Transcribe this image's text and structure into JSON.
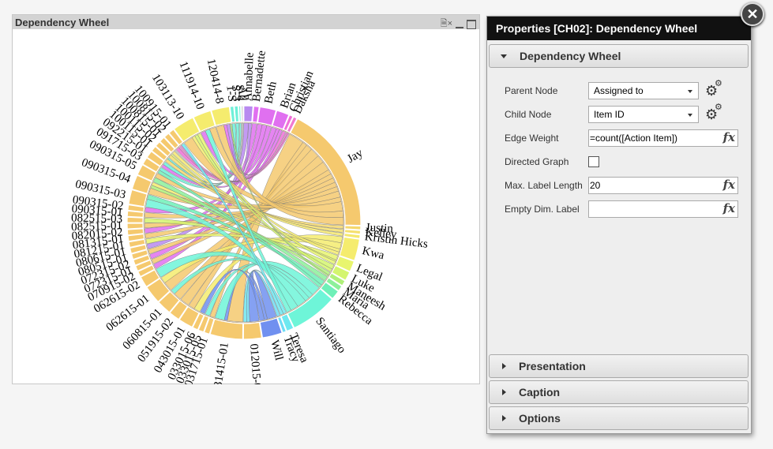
{
  "chart_window": {
    "title": "Dependency Wheel",
    "icons": [
      "clear-selection-icon",
      "minimize-icon",
      "maximize-icon"
    ]
  },
  "properties": {
    "title": "Properties [CH02]: Dependency Wheel",
    "section_main": "Dependency Wheel",
    "fields": {
      "parent_node": {
        "label": "Parent Node",
        "value": "Assigned to"
      },
      "child_node": {
        "label": "Child Node",
        "value": "Item ID"
      },
      "edge_weight": {
        "label": "Edge Weight",
        "value": "=count([Action Item])"
      },
      "directed_graph": {
        "label": "Directed Graph",
        "checked": false
      },
      "max_label_length": {
        "label": "Max. Label Length",
        "value": "20"
      },
      "empty_dim_label": {
        "label": "Empty Dim. Label",
        "value": ""
      }
    },
    "fx_label": "fx",
    "sections": [
      "Presentation",
      "Caption",
      "Options"
    ]
  },
  "chart_data": {
    "type": "chord",
    "nodes": [
      {
        "label": "1-S",
        "color": "#6ef0d8"
      },
      {
        "label": "S-3",
        "color": "#6ef0d8"
      },
      {
        "label": "S-4",
        "color": "#6ef0d8"
      },
      {
        "label": "All",
        "color": "#c8c8c8"
      },
      {
        "label": "Annabelle",
        "color": "#b88af0"
      },
      {
        "label": "Bernadette",
        "color": "#e070f0"
      },
      {
        "label": "Beth",
        "color": "#e070f0"
      },
      {
        "label": "Brian",
        "color": "#e070f0"
      },
      {
        "label": "Christian",
        "color": "#f070d8"
      },
      {
        "label": "Daksha",
        "color": "#f07ad0"
      },
      {
        "label": "Jay",
        "color": "#f5c96e"
      },
      {
        "label": "Justin",
        "color": "#f5d86e"
      },
      {
        "label": "Kelley",
        "color": "#f5e06e"
      },
      {
        "label": "Kristin Hicks",
        "color": "#f5e86e"
      },
      {
        "label": "Kwa",
        "color": "#f5ec6e"
      },
      {
        "label": "Legal",
        "color": "#e8f56e"
      },
      {
        "label": "Luke",
        "color": "#d4f56e"
      },
      {
        "label": "Maneesh",
        "color": "#b0f07a"
      },
      {
        "label": "Maria",
        "color": "#8cf09a"
      },
      {
        "label": "Rebecca",
        "color": "#6ef0b8"
      },
      {
        "label": "Santiago",
        "color": "#6ef5d8"
      },
      {
        "label": "Teresa",
        "color": "#6ee8f0"
      },
      {
        "label": "Tracy",
        "color": "#6edcf5"
      },
      {
        "label": "Will",
        "color": "#7090f0"
      },
      {
        "label": "012015-01",
        "color": "#f5c96e"
      },
      {
        "label": "031415-01",
        "color": "#f5c96e"
      },
      {
        "label": "031715-01",
        "color": "#f5c96e"
      },
      {
        "label": "033015-05",
        "color": "#f5c96e"
      },
      {
        "label": "033015-06",
        "color": "#f5c96e"
      },
      {
        "label": "043015-01",
        "color": "#f5c96e"
      },
      {
        "label": "051915-02",
        "color": "#f5c96e"
      },
      {
        "label": "060815-01",
        "color": "#f5c96e"
      },
      {
        "label": "062615-01",
        "color": "#f5c96e"
      },
      {
        "label": "062615-02",
        "color": "#f5c96e"
      },
      {
        "label": "070915-02",
        "color": "#f5c96e"
      },
      {
        "label": "072315-01",
        "color": "#f5c96e"
      },
      {
        "label": "072315-02",
        "color": "#f5c96e"
      },
      {
        "label": "080515-01",
        "color": "#f5c96e"
      },
      {
        "label": "080615-01",
        "color": "#f5c96e"
      },
      {
        "label": "081215-01",
        "color": "#f5c96e"
      },
      {
        "label": "081315-01",
        "color": "#f5c96e"
      },
      {
        "label": "082015-02",
        "color": "#f5c96e"
      },
      {
        "label": "082515-01",
        "color": "#f5c96e"
      },
      {
        "label": "082515-03",
        "color": "#f5c96e"
      },
      {
        "label": "090315-01",
        "color": "#f5c96e"
      },
      {
        "label": "090315-02",
        "color": "#f5c96e"
      },
      {
        "label": "090315-03",
        "color": "#f5c96e"
      },
      {
        "label": "090315-04",
        "color": "#f5c96e"
      },
      {
        "label": "090315-05",
        "color": "#f5c96e"
      },
      {
        "label": "091715-03",
        "color": "#f5c96e"
      },
      {
        "label": "092215-01",
        "color": "#f5c96e"
      },
      {
        "label": "100115-01",
        "color": "#f5c96e"
      },
      {
        "label": "100115-02",
        "color": "#f5c96e"
      },
      {
        "label": "100815-01",
        "color": "#f5c96e"
      },
      {
        "label": "100815-02",
        "color": "#f5c96e"
      },
      {
        "label": "100915-01",
        "color": "#f5c96e"
      },
      {
        "label": "103113-10",
        "color": "#f5ec6e"
      },
      {
        "label": "111914-10",
        "color": "#f5ec6e"
      },
      {
        "label": "120414-8",
        "color": "#f5ec6e"
      }
    ],
    "edges": [
      [
        "012015-01",
        "Will",
        6
      ],
      [
        "012015-01",
        "Tracy",
        2
      ],
      [
        "012015-01",
        "Teresa",
        2
      ],
      [
        "031415-01",
        "Jay",
        10
      ],
      [
        "031415-01",
        "Will",
        2
      ],
      [
        "031415-01",
        "Santiago",
        6
      ],
      [
        "031715-01",
        "Jay",
        3
      ],
      [
        "033015-05",
        "Santiago",
        3
      ],
      [
        "033015-06",
        "Will",
        3
      ],
      [
        "043015-01",
        "Kwa",
        4
      ],
      [
        "043015-01",
        "Jay",
        4
      ],
      [
        "051915-02",
        "Jay",
        6
      ],
      [
        "060815-01",
        "Jay",
        5
      ],
      [
        "060815-01",
        "Santiago",
        3
      ],
      [
        "062615-01",
        "Jay",
        6
      ],
      [
        "062615-01",
        "Kwa",
        4
      ],
      [
        "062615-02",
        "Santiago",
        6
      ],
      [
        "070915-02",
        "Beth",
        3
      ],
      [
        "072315-01",
        "Jay",
        3
      ],
      [
        "072315-02",
        "Brian",
        3
      ],
      [
        "080515-01",
        "Jay",
        3
      ],
      [
        "080615-01",
        "Annabelle",
        3
      ],
      [
        "081215-01",
        "Legal",
        3
      ],
      [
        "081315-01",
        "Jay",
        3
      ],
      [
        "082015-02",
        "Bernadette",
        3
      ],
      [
        "082515-01",
        "Jay",
        3
      ],
      [
        "082515-03",
        "Luke",
        3
      ],
      [
        "090315-01",
        "Jay",
        3
      ],
      [
        "090315-02",
        "Beth",
        3
      ],
      [
        "090315-03",
        "Santiago",
        5
      ],
      [
        "090315-03",
        "Rebecca",
        3
      ],
      [
        "090315-04",
        "Jay",
        4
      ],
      [
        "090315-04",
        "Maneesh",
        2
      ],
      [
        "090315-04",
        "Kwa",
        2
      ],
      [
        "090315-05",
        "Maria",
        3
      ],
      [
        "090315-05",
        "Jay",
        3
      ],
      [
        "091715-03",
        "Rebecca",
        2
      ],
      [
        "091715-03",
        "1-S",
        2
      ],
      [
        "092215-01",
        "Brian",
        2
      ],
      [
        "092215-01",
        "S-3",
        2
      ],
      [
        "100115-01",
        "Justin",
        2
      ],
      [
        "100115-01",
        "S-4",
        1
      ],
      [
        "100115-02",
        "Kelley",
        2
      ],
      [
        "100115-02",
        "Legal",
        1
      ],
      [
        "100815-01",
        "Kristin Hicks",
        2
      ],
      [
        "100815-01",
        "All",
        1
      ],
      [
        "100815-02",
        "Christian",
        2
      ],
      [
        "100815-02",
        "Daksha",
        1
      ],
      [
        "100915-01",
        "Daksha",
        1
      ],
      [
        "100915-01",
        "Teresa",
        2
      ],
      [
        "103113-10",
        "Jay",
        6
      ],
      [
        "103113-10",
        "Kwa",
        2
      ],
      [
        "103113-10",
        "Luke",
        2
      ],
      [
        "103113-10",
        "Legal",
        2
      ],
      [
        "111914-10",
        "Beth",
        3
      ],
      [
        "111914-10",
        "Santiago",
        3
      ],
      [
        "111914-10",
        "Jay",
        4
      ],
      [
        "120414-8",
        "Jay",
        5
      ],
      [
        "120414-8",
        "Brian",
        2
      ],
      [
        "120414-8",
        "Annabelle",
        2
      ],
      [
        "120414-8",
        "Maneesh",
        1
      ]
    ]
  }
}
